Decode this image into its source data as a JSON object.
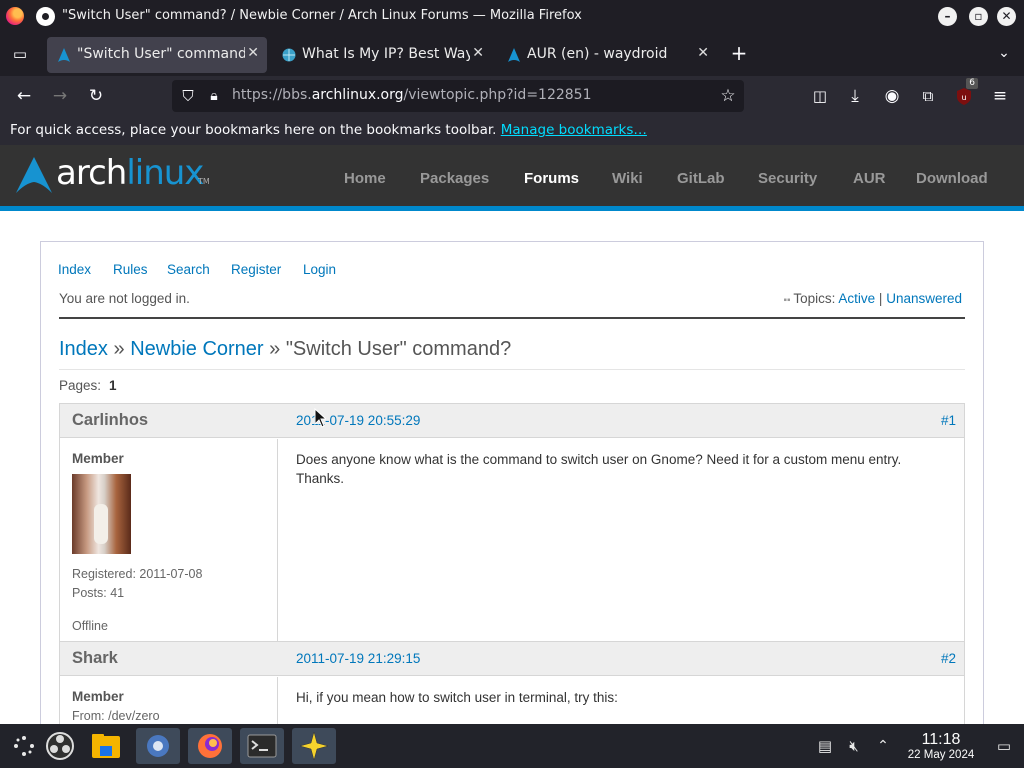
{
  "window": {
    "title": "\"Switch User\" command? / Newbie Corner / Arch Linux Forums — Mozilla Firefox"
  },
  "tabs": [
    {
      "label": "\"Switch User\" command?",
      "active": true
    },
    {
      "label": "What Is My IP? Best Way",
      "active": false
    },
    {
      "label": "AUR (en) - waydroid",
      "active": false
    }
  ],
  "address_bar": {
    "url_prefix": "https://bbs.",
    "url_domain": "archlinux.org",
    "url_suffix": "/viewtopic.php?id=122851"
  },
  "extensions": {
    "ublock_badge": "6"
  },
  "bookmarks_bar": {
    "message": "For quick access, place your bookmarks here on the bookmarks toolbar.",
    "link": "Manage bookmarks…"
  },
  "arch_header": {
    "logo_text_1": "arch",
    "logo_text_2": "linux",
    "logo_tm": "TM",
    "nav": [
      "Home",
      "Packages",
      "Forums",
      "Wiki",
      "GitLab",
      "Security",
      "AUR",
      "Download"
    ],
    "active_nav": "Forums"
  },
  "forum": {
    "top_links": [
      "Index",
      "Rules",
      "Search",
      "Register",
      "Login"
    ],
    "login_status": "You are not logged in.",
    "topics_label": "Topics:",
    "topics_active": "Active",
    "topics_sep": "|",
    "topics_unanswered": "Unanswered",
    "breadcrumb": {
      "index": "Index",
      "sep": "»",
      "forum": "Newbie Corner",
      "topic": "\"Switch User\" command?"
    },
    "pages_label": "Pages:",
    "pages_current": "1",
    "posts": [
      {
        "author": "Carlinhos",
        "date": "2011-07-19 20:55:29",
        "number": "#1",
        "rank": "Member",
        "registered": "Registered: 2011-07-08",
        "posts": "Posts: 41",
        "status": "Offline",
        "body_line_1": "Does anyone know what is the command to switch user on Gnome? Need it for a custom menu entry.",
        "body_line_2": "Thanks."
      },
      {
        "author": "Shark",
        "date": "2011-07-19 21:29:15",
        "number": "#2",
        "rank": "Member",
        "from": "From: /dev/zero",
        "body_line_1": "Hi, if you mean how to switch user in terminal, try this:"
      }
    ]
  },
  "taskbar": {
    "time": "11:18",
    "date": "22 May 2024"
  }
}
